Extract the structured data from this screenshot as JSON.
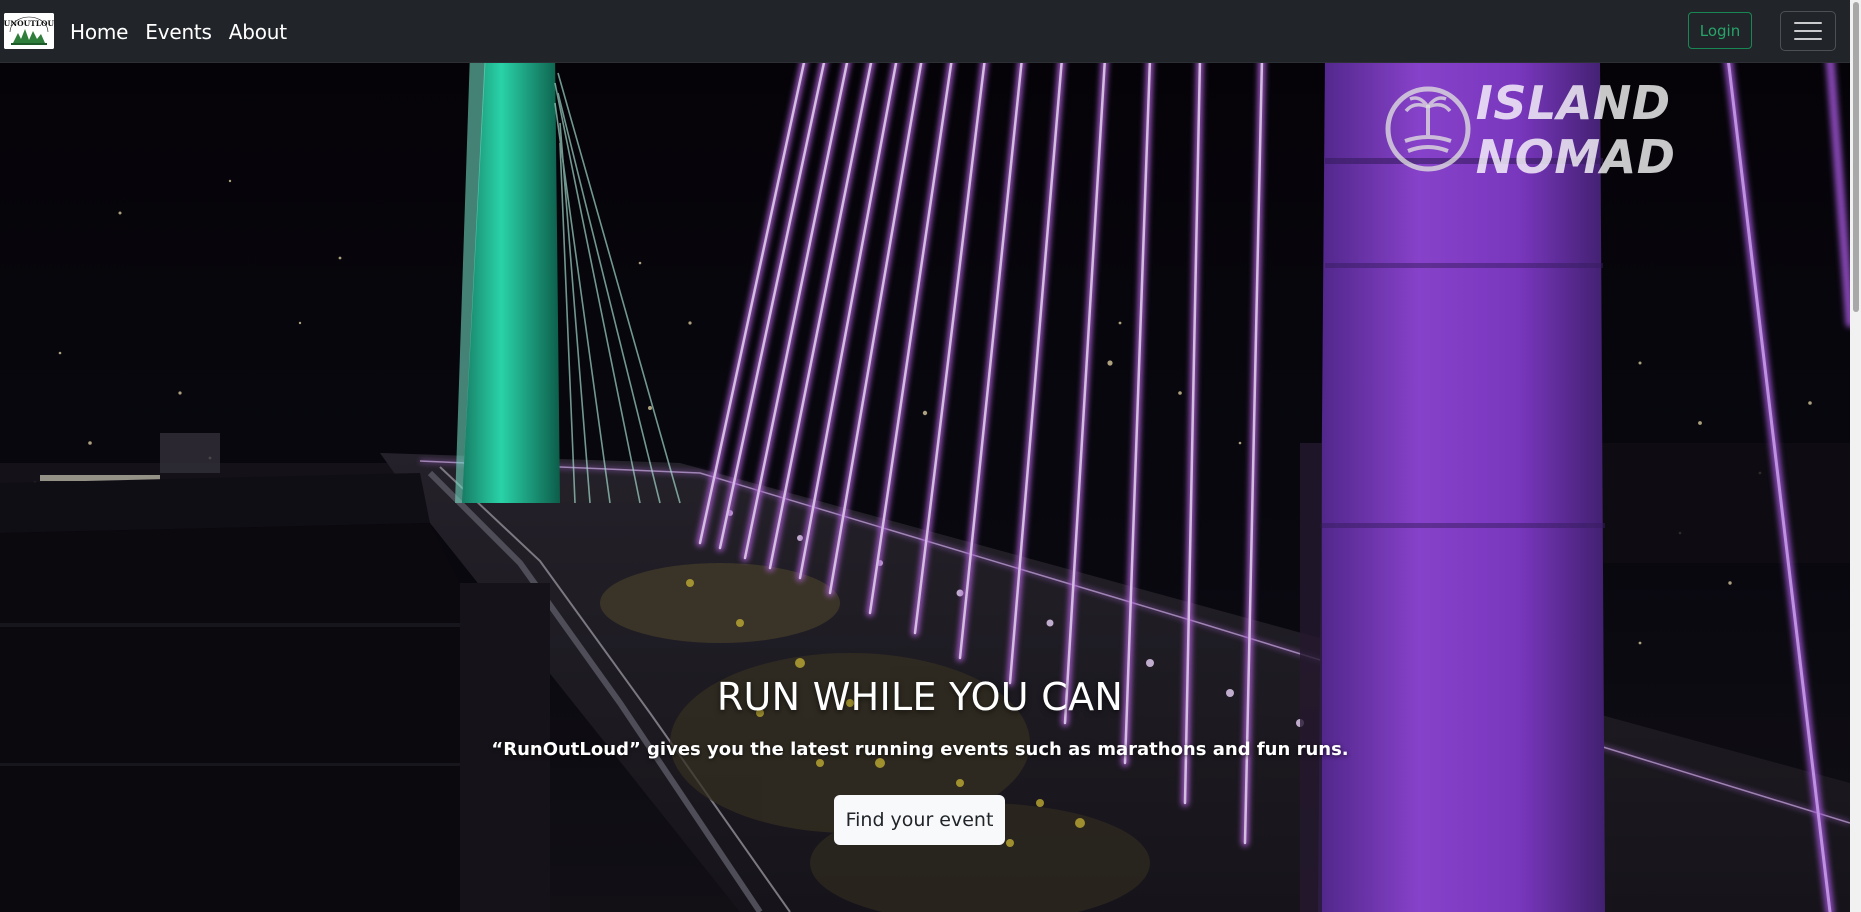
{
  "navbar": {
    "brand_logo_text": "RUNOUTLOUD",
    "links": [
      "Home",
      "Events",
      "About"
    ],
    "login_label": "Login"
  },
  "hero": {
    "title": "RUN WHILE YOU CAN",
    "subtitle": "“RunOutLoud” gives you the latest running events such as marathons and fun runs.",
    "cta_label": "Find your event",
    "sponsor_text": "ISLAND NOMAD"
  },
  "colors": {
    "navbar_bg": "#212529",
    "login_border": "#198754",
    "tower_teal": "#1fd6a8",
    "cable_purple": "#c46cf5"
  }
}
